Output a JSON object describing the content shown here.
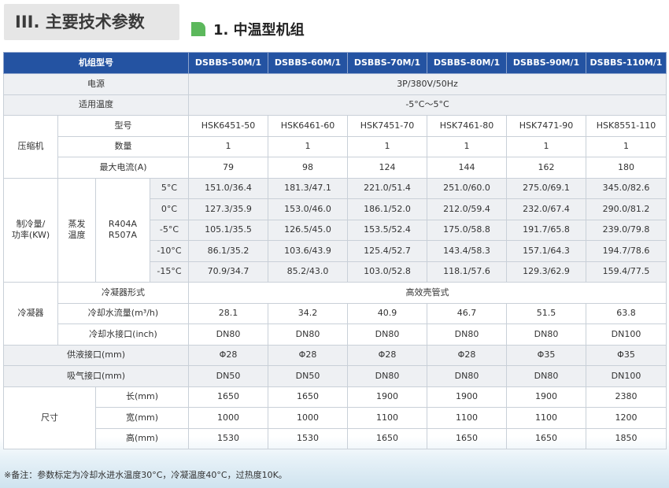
{
  "section_title": "III. 主要技术参数",
  "subtitle": "1. 中温型机组",
  "header": {
    "model_label": "机组型号",
    "models": [
      "DSBBS-50M/1",
      "DSBBS-60M/1",
      "DSBBS-70M/1",
      "DSBBS-80M/1",
      "DSBBS-90M/1",
      "DSBBS-110M/1"
    ]
  },
  "power": {
    "label": "电源",
    "value": "3P/380V/50Hz"
  },
  "temp_range": {
    "label": "适用温度",
    "value": "-5°C～5°C"
  },
  "compressor": {
    "label": "压缩机",
    "model": {
      "label": "型号",
      "values": [
        "HSK6451-50",
        "HSK6461-60",
        "HSK7451-70",
        "HSK7461-80",
        "HSK7471-90",
        "HSK8551-110"
      ]
    },
    "qty": {
      "label": "数量",
      "values": [
        "1",
        "1",
        "1",
        "1",
        "1",
        "1"
      ]
    },
    "current": {
      "label": "最大电流(A)",
      "values": [
        "79",
        "98",
        "124",
        "144",
        "162",
        "180"
      ]
    }
  },
  "cooling": {
    "label_line1": "制冷量/",
    "label_line2": "功率(KW)",
    "evap_line1": "蒸发",
    "evap_line2": "温度",
    "refrigerant_line1": "R404A",
    "refrigerant_line2": "R507A",
    "rows": [
      {
        "temp": "5°C",
        "values": [
          "151.0/36.4",
          "181.3/47.1",
          "221.0/51.4",
          "251.0/60.0",
          "275.0/69.1",
          "345.0/82.6"
        ]
      },
      {
        "temp": "0°C",
        "values": [
          "127.3/35.9",
          "153.0/46.0",
          "186.1/52.0",
          "212.0/59.4",
          "232.0/67.4",
          "290.0/81.2"
        ]
      },
      {
        "temp": "-5°C",
        "values": [
          "105.1/35.5",
          "126.5/45.0",
          "153.5/52.4",
          "175.0/58.8",
          "191.7/65.8",
          "239.0/79.8"
        ]
      },
      {
        "temp": "-10°C",
        "values": [
          "86.1/35.2",
          "103.6/43.9",
          "125.4/52.7",
          "143.4/58.3",
          "157.1/64.3",
          "194.7/78.6"
        ]
      },
      {
        "temp": "-15°C",
        "values": [
          "70.9/34.7",
          "85.2/43.0",
          "103.0/52.8",
          "118.1/57.6",
          "129.3/62.9",
          "159.4/77.5"
        ]
      }
    ]
  },
  "condenser": {
    "label": "冷凝器",
    "type": {
      "label": "冷凝器形式",
      "value": "高效壳管式"
    },
    "flow": {
      "label": "冷却水流量(m³/h)",
      "values": [
        "28.1",
        "34.2",
        "40.9",
        "46.7",
        "51.5",
        "63.8"
      ]
    },
    "port": {
      "label": "冷却水接口(inch)",
      "values": [
        "DN80",
        "DN80",
        "DN80",
        "DN80",
        "DN80",
        "DN100"
      ]
    }
  },
  "liquid_port": {
    "label": "供液接口(mm)",
    "values": [
      "Φ28",
      "Φ28",
      "Φ28",
      "Φ28",
      "Φ35",
      "Φ35"
    ]
  },
  "suction_port": {
    "label": "吸气接口(mm)",
    "values": [
      "DN50",
      "DN50",
      "DN80",
      "DN80",
      "DN80",
      "DN100"
    ]
  },
  "dimensions": {
    "label": "尺寸",
    "length": {
      "label": "长(mm)",
      "values": [
        "1650",
        "1650",
        "1900",
        "1900",
        "1900",
        "2380"
      ]
    },
    "width": {
      "label": "宽(mm)",
      "values": [
        "1000",
        "1000",
        "1100",
        "1100",
        "1100",
        "1200"
      ]
    },
    "height": {
      "label": "高(mm)",
      "values": [
        "1530",
        "1530",
        "1650",
        "1650",
        "1650",
        "1850"
      ]
    }
  },
  "footnote": "※备注：参数标定为冷却水进水温度30°C，冷凝温度40°C，过热度10K。"
}
